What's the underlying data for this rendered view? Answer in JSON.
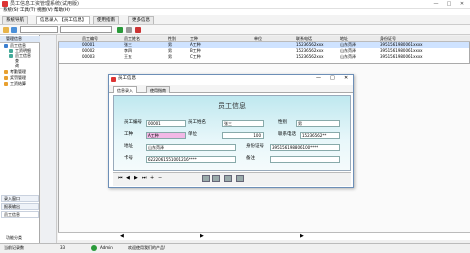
{
  "window": {
    "title": "员工信息工资管理系统(试用版)",
    "minimize": "—",
    "maximize": "□",
    "close": "✕"
  },
  "menu": [
    "系统(S)",
    "工具(T)",
    "视图(V)",
    "帮助(H)"
  ],
  "top_tabs": [
    "系统导航",
    "信息录入 【员工信息】",
    "使用指南",
    "更多信息"
  ],
  "nav": {
    "header": "管理信息",
    "tree": [
      "员工信息",
      "工资明细",
      "员工信息",
      "查",
      "询",
      "考勤管理",
      "奖罚管理",
      "工资结算"
    ],
    "bottom_buttons": [
      "录入窗口",
      "报表输出",
      "员工信息"
    ],
    "footer": "功能分类"
  },
  "grid": {
    "columns": [
      "员工编号",
      "员工姓名",
      "性别",
      "工种",
      "单位",
      "联系电话",
      "地址",
      "身份证号"
    ],
    "rows": [
      [
        "00001",
        "张三",
        "男",
        "A工种",
        "",
        "15236562xxx",
        "山东菏泽",
        "3951561980061xxxx"
      ],
      [
        "00002",
        "李四",
        "男",
        "B工种",
        "",
        "15236562xxx",
        "山东菏泽",
        "3951561980061xxxx"
      ],
      [
        "00003",
        "王五",
        "男",
        "C工种",
        "",
        "15236562xxx",
        "山东菏泽",
        "3951561980061xxxx"
      ]
    ]
  },
  "dialog": {
    "title": "员工信息",
    "tabs": [
      "信息录入",
      "使用指南"
    ],
    "form_title": "员工信息",
    "fields": {
      "emp_no_label": "员工编号",
      "emp_no": "00001",
      "emp_name_label": "员工姓名",
      "emp_name": "张三",
      "gender_label": "性别",
      "gender": "男",
      "job_label": "工种",
      "job": "A工种",
      "unit_label": "单位",
      "unit": "100",
      "phone_label": "联系电话",
      "phone": "15236562**",
      "addr_label": "地址",
      "addr": "山东菏泽",
      "id_label": "身份证号",
      "id": "395156198806100****",
      "card_label": "卡号",
      "card": "6222061551001216****",
      "note_label": "备注",
      "note": ""
    }
  },
  "status": {
    "count": "33",
    "user": "Admin",
    "msg": "欢迎使用我们的产品!",
    "left": "当前记录数"
  }
}
